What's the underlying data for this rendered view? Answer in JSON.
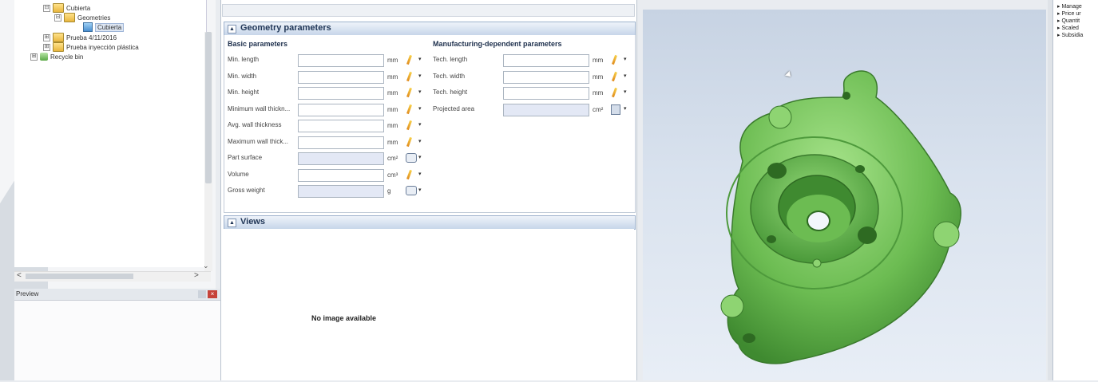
{
  "tree": {
    "items": [
      {
        "label": "Cubierta",
        "expander": "⊟",
        "icon": "folder-icon"
      },
      {
        "label": "Geometries",
        "expander": "⊟",
        "icon": "folder-open-icon"
      },
      {
        "label": "Cubierta",
        "expander": "",
        "icon": "part-icon",
        "selected": true
      },
      {
        "label": "Prueba 4/11/2016",
        "expander": "⊞",
        "icon": "folder-icon"
      },
      {
        "label": "Prueba inyección plástica",
        "expander": "⊞",
        "icon": "folder-icon"
      },
      {
        "label": "Recycle bin",
        "expander": "⊞",
        "icon": "recycle-bin-icon"
      }
    ],
    "scroll_down": "⌄",
    "scroll_left": "<",
    "scroll_right": ">"
  },
  "preview": {
    "title": "Preview"
  },
  "geometry": {
    "title": "Geometry parameters",
    "collapse_glyph": "▲",
    "basic": {
      "title": "Basic parameters",
      "rows": [
        {
          "label": "Min. length",
          "unit": "mm",
          "value": "",
          "tool": "pen"
        },
        {
          "label": "Min. width",
          "unit": "mm",
          "value": "",
          "tool": "pen"
        },
        {
          "label": "Min. height",
          "unit": "mm",
          "value": "",
          "tool": "pen"
        },
        {
          "label": "Minimum wall thickn...",
          "unit": "mm",
          "value": "",
          "tool": "pen"
        },
        {
          "label": "Avg. wall thickness",
          "unit": "mm",
          "value": "",
          "tool": "pen"
        },
        {
          "label": "Maximum wall thick...",
          "unit": "mm",
          "value": "",
          "tool": "pen"
        },
        {
          "label": "Part surface",
          "unit": "cm²",
          "value": "",
          "tool": "gear",
          "readonly": true
        },
        {
          "label": "Volume",
          "unit": "cm³",
          "value": "",
          "tool": "pen"
        },
        {
          "label": "Gross weight",
          "unit": "g",
          "value": "",
          "tool": "gear",
          "readonly": true
        }
      ]
    },
    "manufacturing": {
      "title": "Manufacturing-dependent parameters",
      "rows": [
        {
          "label": "Tech. length",
          "unit": "mm",
          "value": "",
          "tool": "pen"
        },
        {
          "label": "Tech. width",
          "unit": "mm",
          "value": "",
          "tool": "pen"
        },
        {
          "label": "Tech. height",
          "unit": "mm",
          "value": "",
          "tool": "pen"
        },
        {
          "label": "Projected area",
          "unit": "cm²",
          "value": "",
          "tool": "calc",
          "readonly": true
        }
      ]
    }
  },
  "views": {
    "title": "Views",
    "collapse_glyph": "▲",
    "empty_text": "No image available"
  },
  "right_panel": {
    "items": [
      "▸ Manage",
      "▸ Price ur",
      "▸ Quantit",
      "▸ Scaled",
      "▸ Subsidia"
    ]
  },
  "colors": {
    "part_green": "#78c560",
    "header_blue": "#1f3556"
  }
}
